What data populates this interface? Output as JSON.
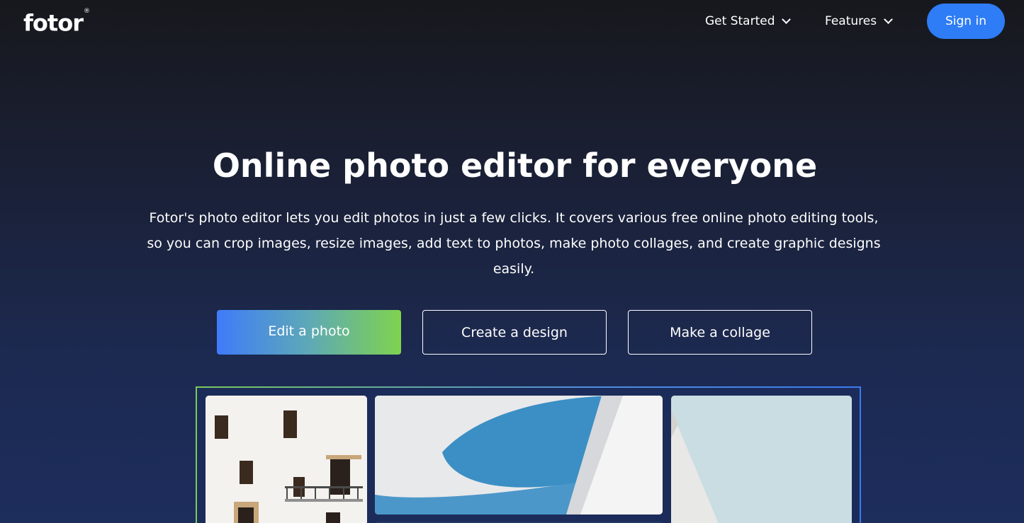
{
  "header": {
    "logo_text": "fotor",
    "logo_mark": "®",
    "nav": [
      {
        "label": "Get Started"
      },
      {
        "label": "Features"
      }
    ],
    "signin_label": "Sign in"
  },
  "hero": {
    "title": "Online photo editor for everyone",
    "description": "Fotor's photo editor lets you edit photos in just a few clicks. It covers various free online photo editing tools, so you can crop images, resize images, add text to photos, make photo collages, and create graphic designs easily.",
    "buttons": [
      {
        "label": "Edit a photo"
      },
      {
        "label": "Create a design"
      },
      {
        "label": "Make a collage"
      }
    ]
  },
  "colors": {
    "signin_bg": "#2e7cf6",
    "edit_gradient_start": "#3f7bfa",
    "edit_gradient_end": "#7fd34e",
    "page_bg_top": "#17181d",
    "page_bg_bottom": "#1d2d5c"
  },
  "icons": {
    "nav_dropdown": "chevron-down-icon"
  }
}
